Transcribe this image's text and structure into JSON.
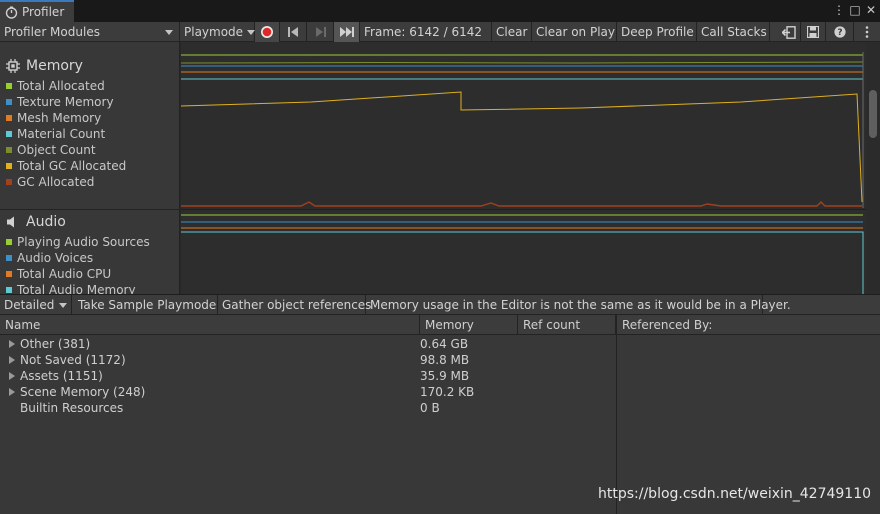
{
  "window": {
    "tab_title": "Profiler",
    "window_controls": [
      "⋮",
      "□",
      "✕"
    ]
  },
  "toolbar": {
    "modules_dropdown": "Profiler Modules",
    "target_dropdown": "Playmode",
    "frame_label": "Frame: 6142 / 6142",
    "clear": "Clear",
    "clear_on_play": "Clear on Play",
    "deep_profile": "Deep Profile",
    "call_stacks": "Call Stacks",
    "icons": [
      "record-icon",
      "step-back-icon",
      "step-forward-icon",
      "current-frame-icon",
      "load-icon",
      "save-icon",
      "help-icon",
      "more-icon"
    ]
  },
  "modules": [
    {
      "name": "Memory",
      "icon": "memory-chip-icon",
      "items": [
        {
          "label": "Total Allocated",
          "color": "#9acd32"
        },
        {
          "label": "Texture Memory",
          "color": "#3d8fc6"
        },
        {
          "label": "Mesh Memory",
          "color": "#e07b24"
        },
        {
          "label": "Material Count",
          "color": "#5fc9d4"
        },
        {
          "label": "Object Count",
          "color": "#7a8f2a"
        },
        {
          "label": "Total GC Allocated",
          "color": "#e0b020"
        },
        {
          "label": "GC Allocated",
          "color": "#a0401e"
        }
      ]
    },
    {
      "name": "Audio",
      "icon": "speaker-icon",
      "items": [
        {
          "label": "Playing Audio Sources",
          "color": "#9acd32"
        },
        {
          "label": "Audio Voices",
          "color": "#3d8fc6"
        },
        {
          "label": "Total Audio CPU",
          "color": "#e07b24"
        },
        {
          "label": "Total Audio Memory",
          "color": "#5fc9d4"
        }
      ]
    }
  ],
  "details_toolbar": {
    "view_dropdown": "Detailed",
    "take_sample": "Take Sample Playmode",
    "gather_refs": "Gather object references",
    "info": "Memory usage in the Editor is not the same as it would be in a Player."
  },
  "table": {
    "columns": [
      "Name",
      "Memory",
      "Ref count"
    ],
    "rows": [
      {
        "name": "Other (381)",
        "memory": "0.64 GB",
        "ref_count": "",
        "expandable": true
      },
      {
        "name": "Not Saved (1172)",
        "memory": "98.8 MB",
        "ref_count": "",
        "expandable": true
      },
      {
        "name": "Assets (1151)",
        "memory": "35.9 MB",
        "ref_count": "",
        "expandable": true
      },
      {
        "name": "Scene Memory (248)",
        "memory": "170.2 KB",
        "ref_count": "",
        "expandable": true
      },
      {
        "name": "Builtin Resources",
        "memory": "0 B",
        "ref_count": "",
        "expandable": false
      }
    ]
  },
  "references": {
    "header": "Referenced By:"
  },
  "watermark": "https://blog.csdn.net/weixin_42749110"
}
